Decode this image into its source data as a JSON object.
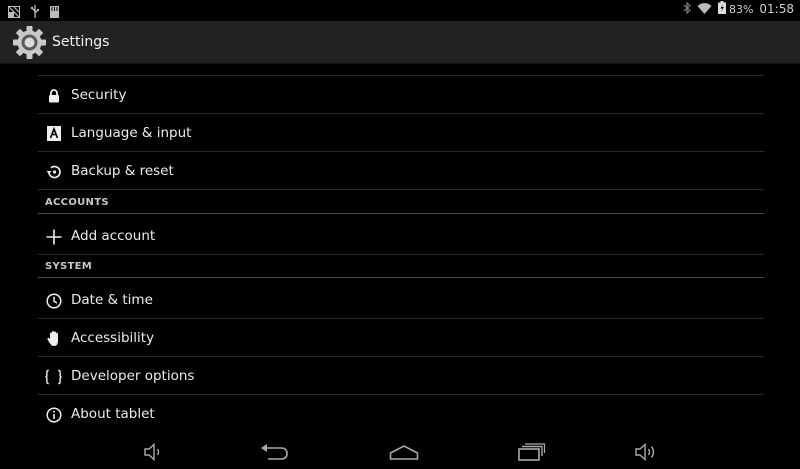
{
  "status_bar": {
    "battery_percent": "83%",
    "time": "01:58",
    "icons": [
      "screenshot-icon",
      "usb-icon",
      "sd-card-icon",
      "bluetooth-icon",
      "wifi-icon",
      "battery-icon"
    ]
  },
  "action_bar": {
    "title": "Settings",
    "icon": "settings-gear-icon"
  },
  "settings": {
    "personal": [
      {
        "label": "Security",
        "icon": "lock-icon"
      },
      {
        "label": "Language & input",
        "icon": "language-icon"
      },
      {
        "label": "Backup & reset",
        "icon": "backup-icon"
      }
    ],
    "accounts_header": "ACCOUNTS",
    "accounts": [
      {
        "label": "Add account",
        "icon": "plus-icon"
      }
    ],
    "system_header": "SYSTEM",
    "system": [
      {
        "label": "Date & time",
        "icon": "clock-icon"
      },
      {
        "label": "Accessibility",
        "icon": "hand-icon"
      },
      {
        "label": "Developer options",
        "icon": "braces-icon"
      },
      {
        "label": "About tablet",
        "icon": "info-icon"
      }
    ]
  },
  "nav_bar": {
    "buttons": [
      "volume-down-icon",
      "back-icon",
      "home-icon",
      "recents-icon",
      "volume-up-icon"
    ]
  },
  "colors": {
    "background": "#000000",
    "action_bar": "#222222",
    "divider": "#2a2a2a",
    "section_divider": "#4a4a4a",
    "text": "#ececec"
  }
}
